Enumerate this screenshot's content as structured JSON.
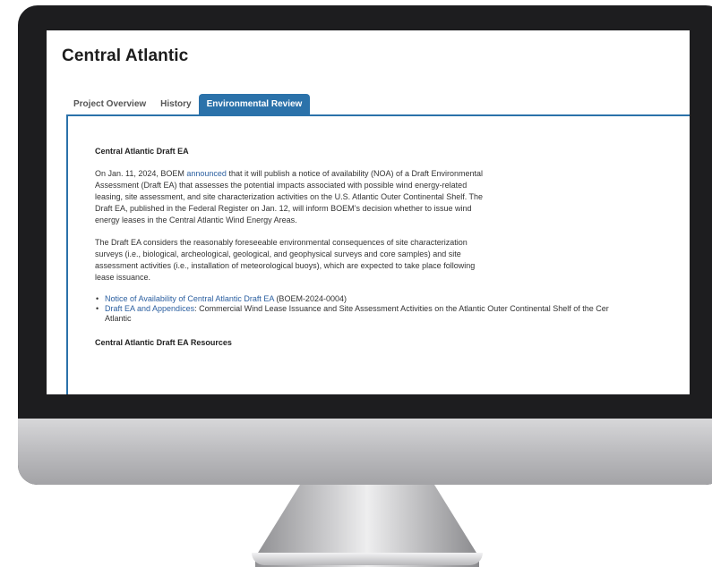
{
  "page": {
    "title": "Central Atlantic",
    "tabs": [
      "Project Overview",
      "History",
      "Environmental Review"
    ],
    "active_tab": "Environmental Review"
  },
  "section": {
    "heading": "Central Atlantic Draft EA",
    "p1_pre": "On Jan. 11, 2024, BOEM ",
    "p1_link": "announced",
    "p1_line1": " that it will publish a notice of availability (NOA) of a Draft Environmental",
    "p1_line2": "Assessment (Draft EA) that assesses the potential impacts associated with possible wind energy-related",
    "p1_line3": "leasing, site assessment, and site characterization activities on the U.S. Atlantic Outer Continental Shelf.  The",
    "p1_line4": "Draft EA, published in the Federal Register on Jan. 12, will inform BOEM’s decision whether to issue wind",
    "p1_line5": "energy leases in the Central Atlantic Wind Energy Areas.",
    "p2_line1": "The Draft EA considers the reasonably foreseeable environmental consequences of site characterization",
    "p2_line2": "surveys (i.e., biological, archeological, geological, and geophysical surveys and core samples) and site",
    "p2_line3": "assessment activities (i.e., installation of meteorological buoys), which are expected to take place following",
    "p2_line4": "lease issuance.",
    "bullet1_link": "Notice of Availability of Central Atlantic Draft EA",
    "bullet1_rest": " (BOEM-2024-0004)",
    "bullet2_link": "Draft EA and Appendices",
    "bullet2_rest": ": Commercial Wind Lease Issuance and Site Assessment Activities on the Atlantic Outer Continental Shelf of the Cer",
    "bullet2_cont": "Atlantic",
    "resources_heading": "Central Atlantic Draft EA Resources"
  }
}
